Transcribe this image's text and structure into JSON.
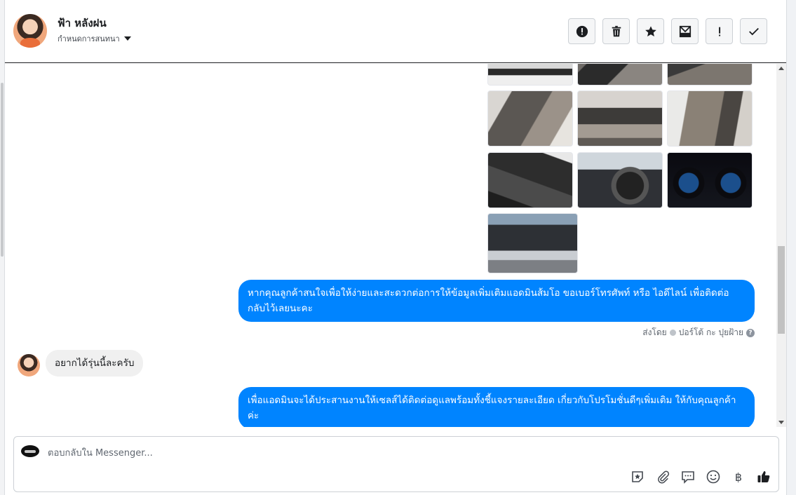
{
  "header": {
    "contact_name": "ฟ้า หลังฝน",
    "conversation_settings": "กำหนดการสนทนา"
  },
  "toolbar": {
    "buttons": [
      {
        "icon": "alert-circle-icon",
        "label": "!"
      },
      {
        "icon": "trash-icon"
      },
      {
        "icon": "star-icon"
      },
      {
        "icon": "mail-archive-icon"
      },
      {
        "icon": "exclamation-icon",
        "label": "!"
      },
      {
        "icon": "checkmark-icon"
      }
    ]
  },
  "thread": {
    "photos": [
      {
        "name": "photo-exterior-front"
      },
      {
        "name": "photo-cabin-console"
      },
      {
        "name": "photo-cabin-gearshift"
      },
      {
        "name": "photo-front-seat"
      },
      {
        "name": "photo-dashboard"
      },
      {
        "name": "photo-rear-seat"
      },
      {
        "name": "photo-door-panel"
      },
      {
        "name": "photo-steering-wheel"
      },
      {
        "name": "photo-gauge-cluster"
      },
      {
        "name": "photo-engine-bay"
      }
    ],
    "messages": [
      {
        "direction": "out",
        "text": "หากคุณลูกค้าสนใจเพื่อให้ง่ายและสะดวกต่อการให้ข้อมูลเพิ่มเติมแอดมินส้มโอ ขอเบอร์โทรศัพท์ หรือ ไอดีไลน์ เพื่อติดต่อกลับไว้เลยนะคะ"
      },
      {
        "direction": "in",
        "text": "อยากได้รุ่นนี้ละครับ"
      },
      {
        "direction": "out",
        "text": "เพื่อแอดมินจะได้ประสานงานให้เซลส์ได้ติดต่อดูแลพร้อมทั้งชี้แจงรายละเอียด เกี่ยวกับโปรโมชั่นดีๆเพิ่มเติม ให้กับคุณลูกค้าค่ะ"
      }
    ],
    "sent_by": {
      "prefix": "ส่งโดย",
      "sender": "ปอร์โต้ กะ ปุยฝ้าย"
    }
  },
  "composer": {
    "placeholder": "ตอบกลับใน Messenger...",
    "tools": [
      {
        "icon": "sticker-icon"
      },
      {
        "icon": "paperclip-icon"
      },
      {
        "icon": "saved-reply-icon"
      },
      {
        "icon": "emoji-icon"
      },
      {
        "icon": "baht-payment-icon",
        "label": "฿"
      },
      {
        "icon": "thumbs-up-icon"
      }
    ]
  },
  "colors": {
    "outgoing_bubble": "#0084ff",
    "incoming_bubble": "#f0f0f0",
    "brand": "#1877f2"
  }
}
